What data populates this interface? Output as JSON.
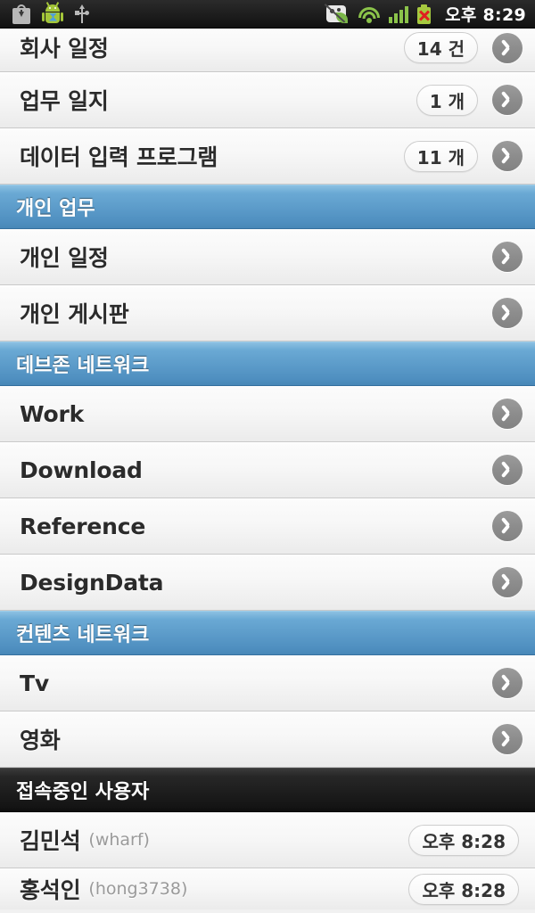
{
  "statusbar": {
    "time": "오후 8:29",
    "icons_left": [
      "download-bag-icon",
      "android-robot-icon",
      "usb-icon"
    ],
    "icons_right": [
      "sync-disabled-icon",
      "wifi-icon",
      "cellular-signal-icon",
      "battery-error-icon"
    ]
  },
  "colors": {
    "section_blue": "#4f8fc0",
    "section_dark": "#141414",
    "row_background": "#f7f7f7",
    "chevron_gray": "#8d8d8d",
    "accent_green": "#8bc34a"
  },
  "list": [
    {
      "kind": "row",
      "label": "회사 일정",
      "badge": "14 건",
      "chevron": true,
      "clip": "top"
    },
    {
      "kind": "row",
      "label": "업무 일지",
      "badge": "1 개",
      "chevron": true
    },
    {
      "kind": "row",
      "label": "데이터 입력 프로그램",
      "badge": "11 개",
      "chevron": true
    },
    {
      "kind": "section",
      "label": "개인 업무",
      "style": "blue"
    },
    {
      "kind": "row",
      "label": "개인 일정",
      "chevron": true
    },
    {
      "kind": "row",
      "label": "개인 게시판",
      "chevron": true
    },
    {
      "kind": "section",
      "label": "데브존 네트워크",
      "style": "blue"
    },
    {
      "kind": "row",
      "label": "Work",
      "chevron": true
    },
    {
      "kind": "row",
      "label": "Download",
      "chevron": true
    },
    {
      "kind": "row",
      "label": "Reference",
      "chevron": true
    },
    {
      "kind": "row",
      "label": "DesignData",
      "chevron": true
    },
    {
      "kind": "section",
      "label": "컨텐츠 네트워크",
      "style": "blue"
    },
    {
      "kind": "row",
      "label": "Tv",
      "chevron": true
    },
    {
      "kind": "row",
      "label": "영화",
      "chevron": true
    },
    {
      "kind": "section",
      "label": "접속중인 사용자",
      "style": "dark"
    },
    {
      "kind": "row",
      "label": "김민석",
      "sub": "(wharf)",
      "badge": "오후 8:28",
      "badge_kind": "time"
    },
    {
      "kind": "row",
      "label": "홍석인",
      "sub": "(hong3738)",
      "badge": "오후 8:28",
      "badge_kind": "time",
      "clip": "bottom"
    }
  ]
}
